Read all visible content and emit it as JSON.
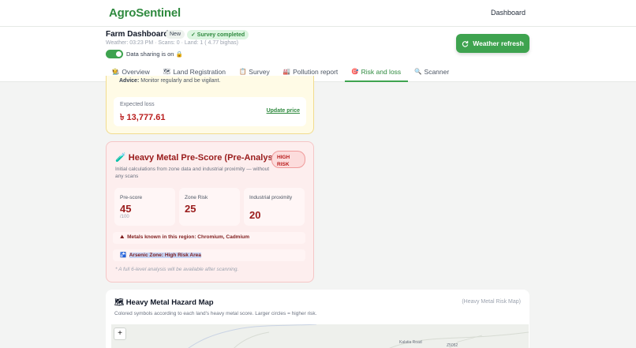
{
  "brand": "AgroSentinel",
  "nav": {
    "dashboard": "Dashboard"
  },
  "farm": {
    "title": "Farm Dashboard",
    "badge_new": "New",
    "badge_survey": "✓ Survey completed",
    "weather": "Weather: 03:23 PM",
    "scans": "Scans: 0",
    "land": "Land: 1 ( 4.77 bighas)",
    "sharing": "Data sharing is on 🔒"
  },
  "weather_button": "Weather refresh",
  "tabs": [
    {
      "icon": "🧑‍🌾",
      "label": "Overview"
    },
    {
      "icon": "🗺",
      "label": "Land Registration"
    },
    {
      "icon": "📋",
      "label": "Survey"
    },
    {
      "icon": "🏭",
      "label": "Pollution report"
    },
    {
      "icon": "🎯",
      "label": "Risk and loss"
    },
    {
      "icon": "🔍",
      "label": "Scanner"
    }
  ],
  "risk_loss": {
    "advice_label": "Advice:",
    "advice_text": "Monitor regularly and be vigilant.",
    "expected_loss_label": "Expected loss",
    "expected_loss_value": "৳ 13,777.61",
    "update_price": "Update price"
  },
  "heavy_metal": {
    "title": "🧪 Heavy Metal Pre-Score (Pre-Analysis)",
    "risk_badge_line1": "HIGH",
    "risk_badge_line2": "RISK",
    "subtitle": "Initial calculations from zone data and industrial proximity — without any scans",
    "stats": [
      {
        "label": "Pre-score",
        "value": "45",
        "sub": "/100"
      },
      {
        "label": "Zone Risk",
        "value": "25"
      },
      {
        "label": "Industrial proximity",
        "value": "20"
      }
    ],
    "metals_icon": "⛰",
    "metals_text": "Metals known in this region: Chromium, Cadmium",
    "arsenic_icon": "🚰",
    "arsenic_text": "Arsenic Zone: High Risk Area",
    "note": "* A full 6-level analysis will be available after scanning."
  },
  "map": {
    "title": "🗺 Heavy Metal Hazard Map",
    "tag": "(Heavy Metal Risk Map)",
    "subtitle": "Colored symbols according to each land's heavy metal score. Larger circles = higher risk.",
    "zoom_in": "+",
    "label_road": "Kalatia Road",
    "label_code": "Z5052"
  },
  "colors": {
    "accent": "#3ea34f",
    "danger": "#991b1b",
    "warning_bg": "#fffbe6"
  }
}
